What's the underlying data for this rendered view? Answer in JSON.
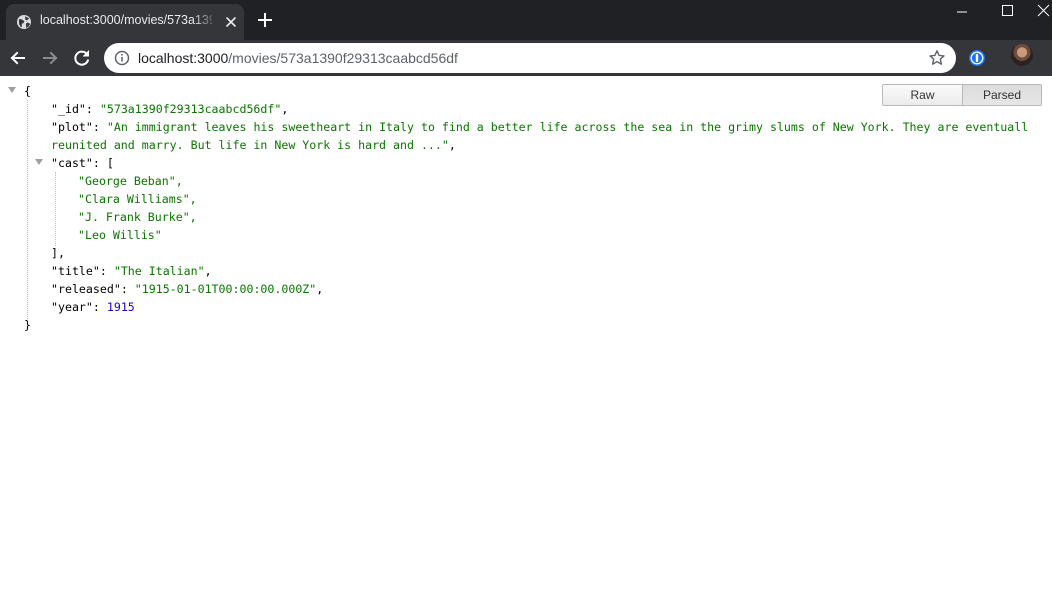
{
  "browser": {
    "tab_title": "localhost:3000/movies/573a1390",
    "url_host": "localhost:3000",
    "url_path": "/movies/573a1390f29313caabcd56df",
    "icons": [
      "globe-icon",
      "close-icon",
      "plus-icon",
      "minimize-icon",
      "maximize-icon",
      "close-window-icon",
      "back-arrow-icon",
      "forward-arrow-icon",
      "reload-icon",
      "info-icon",
      "star-icon",
      "password-manager-icon",
      "avatar"
    ]
  },
  "viewer": {
    "raw_label": "Raw",
    "parsed_label": "Parsed"
  },
  "json": {
    "open_brace": "{",
    "close_brace": "}",
    "id_key": "\"_id\"",
    "id_value": "\"573a1390f29313caabcd56df\"",
    "plot_key": "\"plot\"",
    "plot_value_line1": "\"An immigrant leaves his sweetheart in Italy to find a better life across the sea in the grimy slums of New York. They are eventuall",
    "plot_value_line2": "reunited and marry. But life in New York is hard and ...\"",
    "cast_key": "\"cast\"",
    "cast_open": "[",
    "cast_close": "],",
    "cast": [
      "\"George Beban\",",
      "\"Clara Williams\",",
      "\"J. Frank Burke\",",
      "\"Leo Willis\""
    ],
    "title_key": "\"title\"",
    "title_value": "\"The Italian\"",
    "released_key": "\"released\"",
    "released_value": "\"1915-01-01T00:00:00.000Z\"",
    "year_key": "\"year\"",
    "year_value": "1915"
  },
  "colors": {
    "string": "#0b7500",
    "number": "#1a01cc",
    "chrome_dark": "#202124",
    "chrome_toolbar": "#35363a"
  }
}
